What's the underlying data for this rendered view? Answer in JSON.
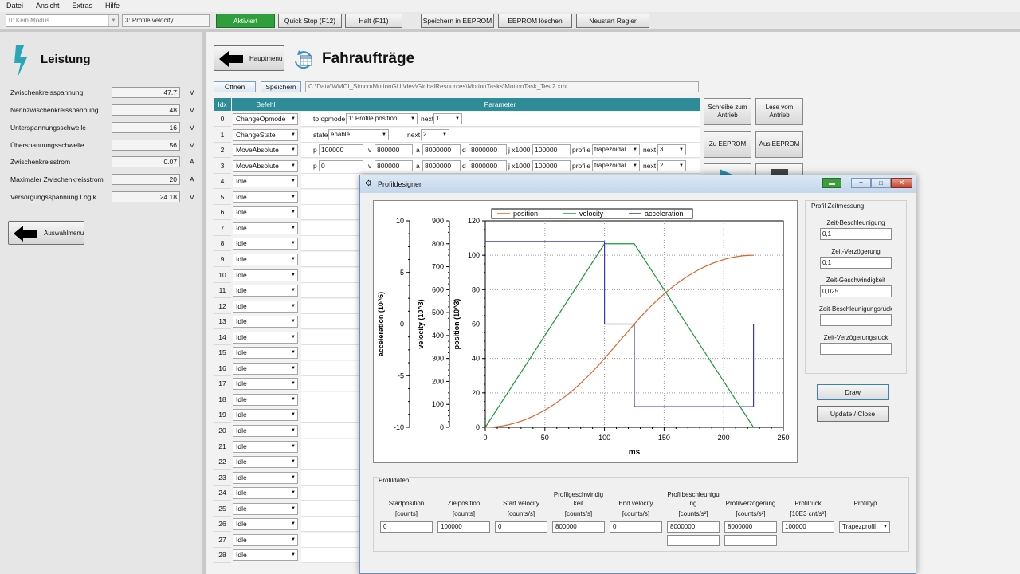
{
  "menu": [
    "Datei",
    "Ansicht",
    "Extras",
    "Hilfe"
  ],
  "toolbar": {
    "mode_combo": "0: Kein Modus",
    "opmode_combo": "3: Profile velocity",
    "activated": "Aktiviert",
    "quick_stop": "Quick Stop (F12)",
    "halt": "Halt (F11)",
    "save_eeprom": "Speichern in EEPROM",
    "delete_eeprom": "EEPROM löschen",
    "restart": "Neustart Regler"
  },
  "left": {
    "title": "Leistung",
    "rows": [
      {
        "label": "Zwischenkreisspannung",
        "value": "47.7",
        "unit": "V"
      },
      {
        "label": "Nennzwischenkreisspannung",
        "value": "48",
        "unit": "V"
      },
      {
        "label": "Unterspannungsschwelle",
        "value": "16",
        "unit": "V"
      },
      {
        "label": "Überspannungsschwelle",
        "value": "56",
        "unit": "V"
      },
      {
        "label": "Zwischenkreisstrom",
        "value": "0.07",
        "unit": "A"
      },
      {
        "label": "Maximaler Zwischenkreisstrom",
        "value": "20",
        "unit": "A"
      },
      {
        "label": "Versorgungsspannung Logik",
        "value": "24.18",
        "unit": "V"
      }
    ],
    "back_button": "Auswahlmenu"
  },
  "main": {
    "back_button": "Hauptmenu",
    "title": "Fahraufträge",
    "open": "Öffnen",
    "save": "Speichern",
    "path": "C:\\Data\\WMCI_Simco\\MotionGUI\\dev\\GlobalResources\\MotionTasks\\MotionTask_Test2.xml",
    "headers": {
      "idx": "Idx",
      "cmd": "Befehl",
      "param": "Parameter"
    },
    "rows": [
      {
        "idx": "0",
        "cmd": "ChangeOpmode"
      },
      {
        "idx": "1",
        "cmd": "ChangeState"
      },
      {
        "idx": "2",
        "cmd": "MoveAbsolute"
      },
      {
        "idx": "3",
        "cmd": "MoveAbsolute"
      },
      {
        "idx": "4",
        "cmd": "Idle"
      },
      {
        "idx": "5",
        "cmd": "Idle"
      },
      {
        "idx": "6",
        "cmd": "Idle"
      },
      {
        "idx": "7",
        "cmd": "Idle"
      },
      {
        "idx": "8",
        "cmd": "Idle"
      },
      {
        "idx": "9",
        "cmd": "Idle"
      },
      {
        "idx": "10",
        "cmd": "Idle"
      },
      {
        "idx": "11",
        "cmd": "Idle"
      },
      {
        "idx": "12",
        "cmd": "Idle"
      },
      {
        "idx": "13",
        "cmd": "Idle"
      },
      {
        "idx": "14",
        "cmd": "Idle"
      },
      {
        "idx": "15",
        "cmd": "Idle"
      },
      {
        "idx": "16",
        "cmd": "Idle"
      },
      {
        "idx": "17",
        "cmd": "Idle"
      },
      {
        "idx": "18",
        "cmd": "Idle"
      },
      {
        "idx": "19",
        "cmd": "Idle"
      },
      {
        "idx": "20",
        "cmd": "Idle"
      },
      {
        "idx": "21",
        "cmd": "Idle"
      },
      {
        "idx": "22",
        "cmd": "Idle"
      },
      {
        "idx": "23",
        "cmd": "Idle"
      },
      {
        "idx": "24",
        "cmd": "Idle"
      },
      {
        "idx": "25",
        "cmd": "Idle"
      },
      {
        "idx": "26",
        "cmd": "Idle"
      },
      {
        "idx": "27",
        "cmd": "Idle"
      },
      {
        "idx": "28",
        "cmd": "Idle"
      }
    ],
    "params": {
      "r0": {
        "l1": "to opmode",
        "v1": "1: Profile position",
        "l2": "next",
        "v2": "1"
      },
      "r1": {
        "l1": "state",
        "v1": "enable",
        "l2": "next",
        "v2": "2"
      },
      "r2": {
        "p": "100000",
        "v": "800000",
        "a": "8000000",
        "d": "8000000",
        "j": "100000",
        "profile": "trapezoidal",
        "next": "3"
      },
      "r3": {
        "p": "0",
        "v": "800000",
        "a": "8000000",
        "d": "8000000",
        "j": "100000",
        "profile": "trapezoidal",
        "next": "2"
      },
      "labels": {
        "p": "p",
        "v": "v",
        "a": "a",
        "d": "d",
        "j": "j x1000",
        "profile": "profile",
        "next": "next"
      }
    },
    "right_buttons": {
      "write": "Schreibe zum Antrieb",
      "read": "Lese vom Antrieb",
      "to_eeprom": "Zu EEPROM",
      "from_eeprom": "Aus EEPROM"
    }
  },
  "dialog": {
    "title": "Profildesigner",
    "timing": {
      "title": "Profil Zeitmessung",
      "fields": [
        {
          "label": "Zeit-Beschleunigung",
          "value": "0,1"
        },
        {
          "label": "Zeit-Verzögerung",
          "value": "0,1"
        },
        {
          "label": "Zeit-Geschwindigkeit",
          "value": "0,025"
        },
        {
          "label": "Zeit-Beschleunigungsruck",
          "value": ""
        },
        {
          "label": "Zeit-Verzögerungsruck",
          "value": ""
        }
      ]
    },
    "draw": "Draw",
    "update_close": "Update / Close",
    "profildaten": {
      "title": "Profildaten",
      "columns": [
        {
          "h1": "Startposition",
          "h2": "[counts]",
          "value": "0"
        },
        {
          "h1": "Zielposition",
          "h2": "[counts]",
          "value": "100000"
        },
        {
          "h1": "Start velocity",
          "h2": "[counts/s]",
          "value": "0"
        },
        {
          "h1": "Profilgeschwindig keit",
          "h2": "[counts/s]",
          "value": "800000"
        },
        {
          "h1": "End velocity",
          "h2": "[counts/s]",
          "value": "0"
        },
        {
          "h1": "Profilbeschleunigu ng",
          "h2": "[counts/s²]",
          "value": "8000000"
        },
        {
          "h1": "Profilverzögerung",
          "h2": "[counts/s²]",
          "value": "8000000"
        },
        {
          "h1": "Profilruck",
          "h2": "[10E3 cnt/s³]",
          "value": "100000"
        },
        {
          "h1": "Profiltyp",
          "h2": "",
          "value": "Trapezprofil"
        }
      ]
    }
  },
  "chart_data": {
    "type": "line",
    "xlabel": "ms",
    "xlim": [
      0,
      250
    ],
    "xticks": [
      "0",
      "50",
      "100",
      "150",
      "200",
      "250"
    ],
    "axes": [
      {
        "label": "acceleration (10^6)",
        "ticks": [
          "10",
          "5",
          "0",
          "-5",
          "-10"
        ],
        "lim": [
          -10,
          10
        ]
      },
      {
        "label": "velocity (10^3)",
        "ticks": [
          "900",
          "800",
          "700",
          "600",
          "500",
          "400",
          "300",
          "200",
          "100",
          "0"
        ],
        "lim": [
          0,
          900
        ]
      },
      {
        "label": "position (10^3)",
        "ticks": [
          "120",
          "100",
          "80",
          "60",
          "40",
          "20",
          "0"
        ],
        "lim": [
          0,
          120
        ]
      }
    ],
    "legend": [
      "position",
      "velocity",
      "acceleration"
    ],
    "colors": {
      "position": "#e0632a",
      "velocity": "#1a9a3a",
      "acceleration": "#3a3aa8"
    },
    "series": [
      {
        "name": "position",
        "axis": "position",
        "x": [
          0,
          25,
          50,
          75,
          100,
          112.5,
          125,
          150,
          175,
          200,
          225
        ],
        "y": [
          0,
          2.5,
          10,
          22.5,
          40,
          50,
          60,
          77.5,
          90,
          97.5,
          100
        ]
      },
      {
        "name": "velocity",
        "axis": "velocity",
        "x": [
          0,
          100,
          125,
          225
        ],
        "y": [
          0,
          800,
          800,
          0
        ]
      },
      {
        "name": "acceleration",
        "axis": "acceleration",
        "x": [
          0,
          100,
          100,
          125,
          125,
          225,
          225
        ],
        "y": [
          8,
          8,
          0,
          0,
          -8,
          -8,
          0
        ]
      }
    ]
  }
}
